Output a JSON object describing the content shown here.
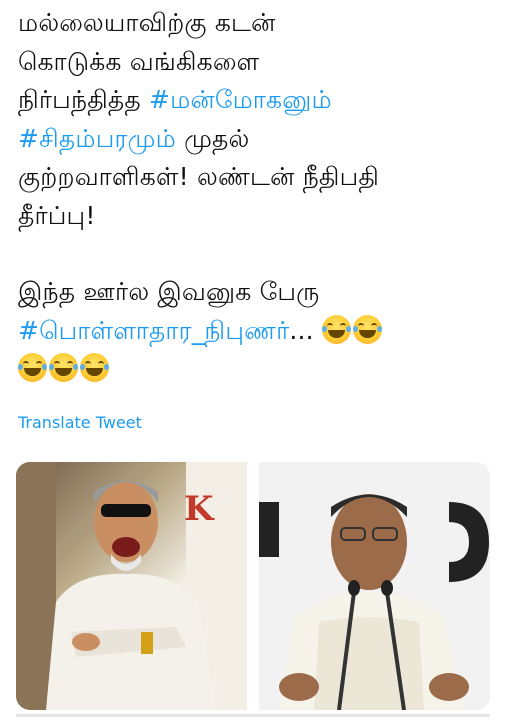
{
  "tweet": {
    "line1": "மல்லையாவிற்கு கடன்",
    "line2": "கொடுக்க வங்கிகளை",
    "line3_text": "நிர்பந்தித்த ",
    "line3_tag": "#மன்மோகனும்",
    "line4_tag": "#சிதம்பரமும்",
    "line4_text": " முதல்",
    "line5": "குற்றவாளிகள்! லண்டன் நீதிபதி",
    "line6": "தீர்ப்பு!",
    "line7": "இந்த ஊர்ல இவனுக பேரு",
    "line8_tag": "#பொள்ளாதார_நிபுணர்",
    "line8_ellipsis": "...",
    "emoji_name": "face-with-tears-of-joy"
  },
  "translate_label": "Translate Tweet",
  "media": {
    "colors": {
      "hashtag": "#1d9bf0",
      "translate": "#1d9bf0"
    }
  }
}
